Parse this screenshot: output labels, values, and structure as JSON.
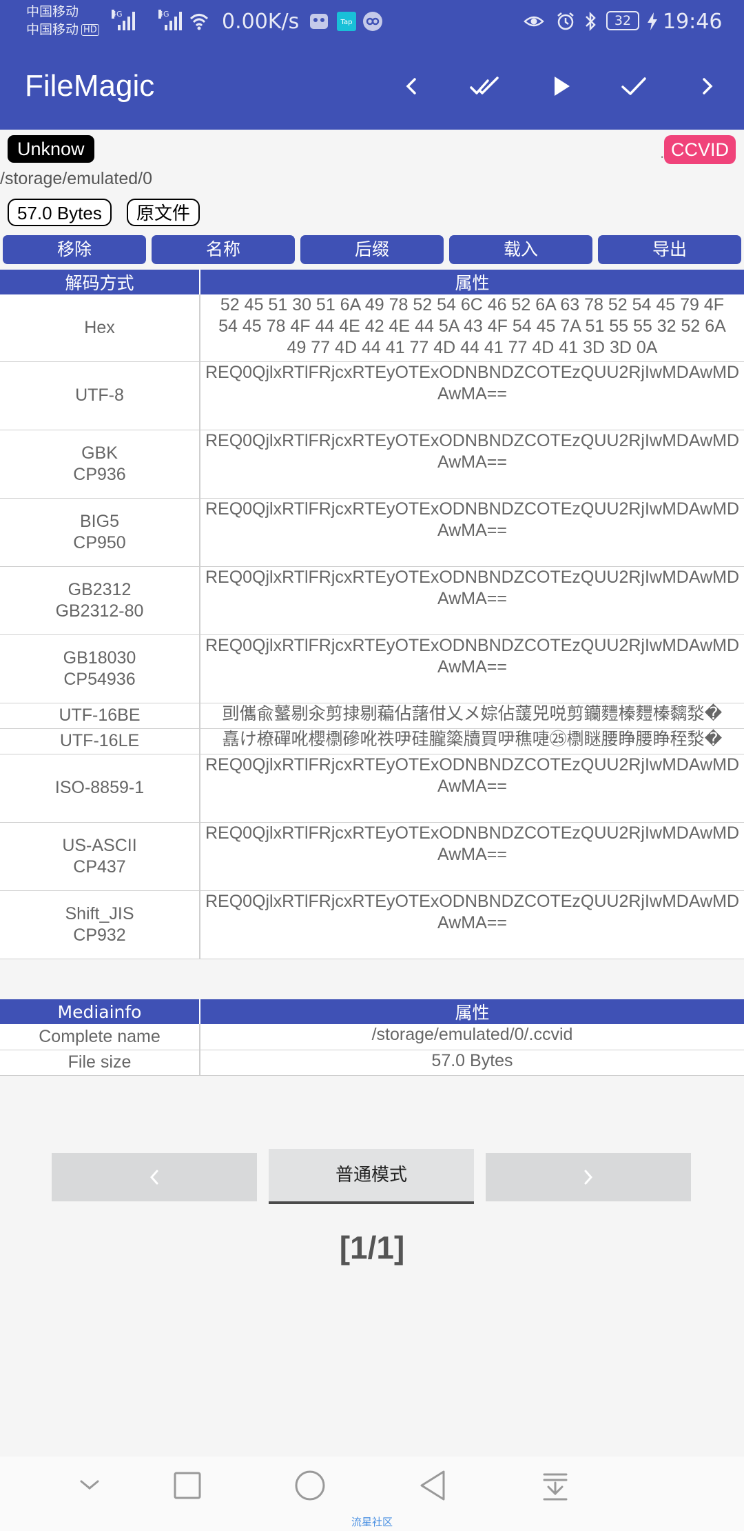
{
  "status_bar": {
    "carrier1": "中国移动",
    "carrier2": "中国移动",
    "hd": "HD",
    "net1": "4G",
    "net2": "4G",
    "speed": "0.00K/s",
    "battery": "32",
    "time": "19:46"
  },
  "app_bar": {
    "title": "FileMagic",
    "icons": [
      "chevron-left-icon",
      "double-check-icon",
      "play-icon",
      "check-icon",
      "chevron-right-icon"
    ]
  },
  "file": {
    "type_badge": "Unknow",
    "ext_badge": "CCVID",
    "ext_dot": ".",
    "path": "/storage/emulated/0",
    "size": "57.0 Bytes",
    "original_label": "原文件"
  },
  "actions": [
    "移除",
    "名称",
    "后缀",
    "载入",
    "导出"
  ],
  "decode_table": {
    "headers": [
      "解码方式",
      "属性"
    ],
    "rows": [
      {
        "key": [
          "Hex"
        ],
        "value": [
          "52 45 51 30 51 6A 49 78 52 54 6C 46 52 6A 63 78 52 54 45 79 4F",
          "54 45 78 4F 44 4E 42 4E 44 5A 43 4F 54 45 7A 51 55 55 32 52 6A",
          "49 77 4D 44 41 77 4D 44 41 77 4D 41 3D 3D 0A"
        ]
      },
      {
        "key": [
          "UTF-8"
        ],
        "value": [
          "REQ0QjlxRTlFRjcxRTEyOTExODNBNDZCOTEzQUU2RjIwMDAwMD",
          "AwMA=="
        ]
      },
      {
        "key": [
          "GBK",
          "CP936"
        ],
        "value": [
          "REQ0QjlxRTlFRjcxRTEyOTExODNBNDZCOTEzQUU2RjIwMDAwMD",
          "AwMA=="
        ]
      },
      {
        "key": [
          "BIG5",
          "CP950"
        ],
        "value": [
          "REQ0QjlxRTlFRjcxRTEyOTExODNBNDZCOTEzQUU2RjIwMDAwMD",
          "AwMA=="
        ]
      },
      {
        "key": [
          "GB2312",
          "GB2312-80"
        ],
        "value": [
          "REQ0QjlxRTlFRjcxRTEyOTExODNBNDZCOTEzQUU2RjIwMDAwMD",
          "AwMA=="
        ]
      },
      {
        "key": [
          "GB18030",
          "CP54936"
        ],
        "value": [
          "REQ0QjlxRTlFRjcxRTEyOTExODNBNDZCOTEzQUU2RjIwMDAwMD",
          "AwMA=="
        ]
      },
      {
        "key": [
          "UTF-16BE"
        ],
        "value": [
          "刯儶兪鼜剔汆剪捸剔藊佔藷佄乂メ婃佔蘐兕哾剪钄麷榛麷榛黐湬�"
        ]
      },
      {
        "key": [
          "UTF-16LE"
        ],
        "value": [
          "嚞け橑磾吪櫻檦磣吪祑吚硅朧簗牘買吚穛啑㉕檦瞇腰睁腰睁秷湬�"
        ]
      },
      {
        "key": [
          "ISO-8859-1"
        ],
        "value": [
          "REQ0QjlxRTlFRjcxRTEyOTExODNBNDZCOTEzQUU2RjIwMDAwMD",
          "AwMA=="
        ]
      },
      {
        "key": [
          "US-ASCII",
          "CP437"
        ],
        "value": [
          "REQ0QjlxRTlFRjcxRTEyOTExODNBNDZCOTEzQUU2RjIwMDAwMD",
          "AwMA=="
        ]
      },
      {
        "key": [
          "Shift_JIS",
          "CP932"
        ],
        "value": [
          "REQ0QjlxRTlFRjcxRTEyOTExODNBNDZCOTEzQUU2RjIwMDAwMD",
          "AwMA=="
        ]
      }
    ]
  },
  "media_table": {
    "headers": [
      "Mediainfo",
      "属性"
    ],
    "rows": [
      {
        "key": [
          "Complete name"
        ],
        "value": [
          "/storage/emulated/0/.ccvid"
        ]
      },
      {
        "key": [
          "File size"
        ],
        "value": [
          "57.0 Bytes"
        ]
      }
    ]
  },
  "pager": {
    "mode_label": "普通模式",
    "page_text": "[1/1]"
  },
  "watermark": "流星社区"
}
